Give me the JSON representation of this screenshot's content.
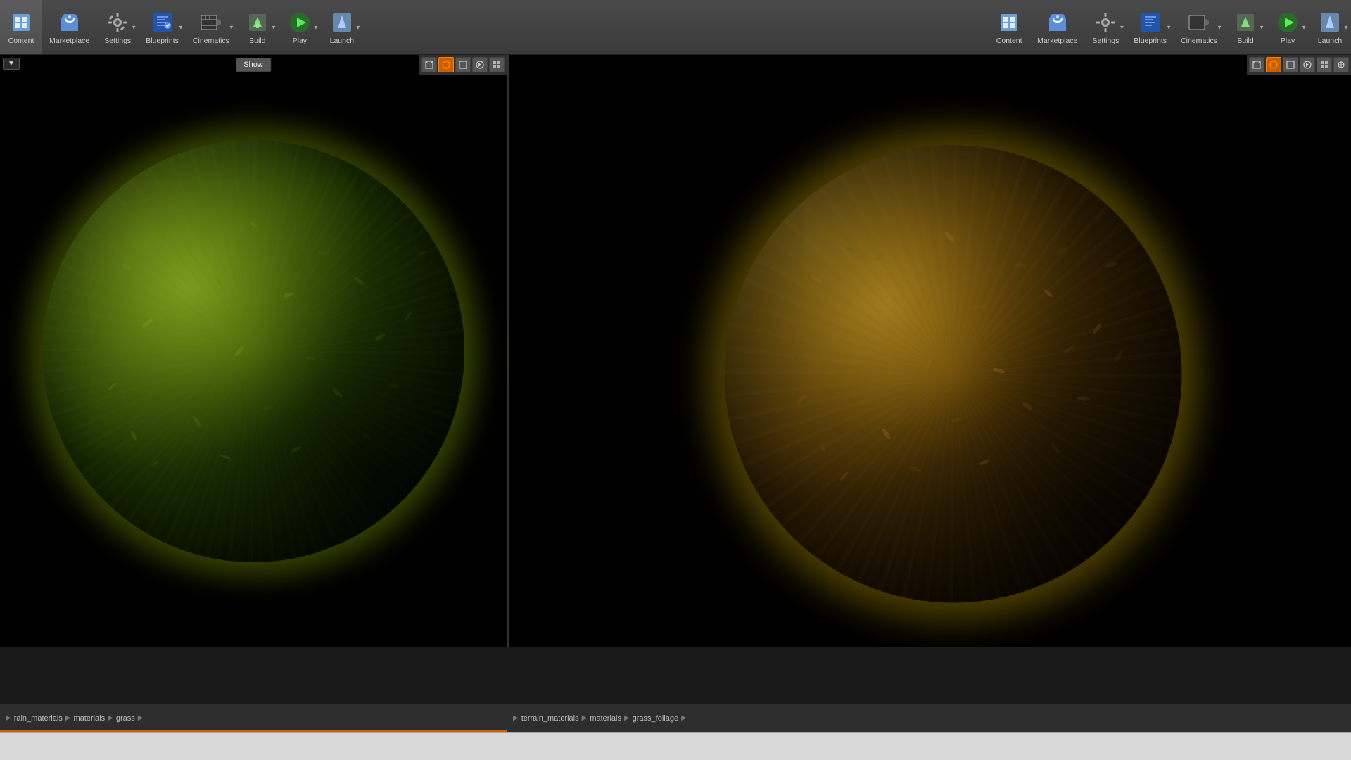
{
  "toolbar_left": {
    "buttons": [
      {
        "id": "content",
        "label": "Content",
        "icon": "content-icon"
      },
      {
        "id": "marketplace",
        "label": "Marketplace",
        "icon": "marketplace-icon",
        "has_dropdown": false
      },
      {
        "id": "settings",
        "label": "Settings",
        "icon": "settings-icon",
        "has_dropdown": true
      },
      {
        "id": "blueprints",
        "label": "Blueprints",
        "icon": "blueprints-icon",
        "has_dropdown": true
      },
      {
        "id": "cinematics",
        "label": "Cinematics",
        "icon": "cinematics-icon",
        "has_dropdown": true
      },
      {
        "id": "build",
        "label": "Build",
        "icon": "build-icon",
        "has_dropdown": true
      },
      {
        "id": "play",
        "label": "Play",
        "icon": "play-icon",
        "has_dropdown": true
      },
      {
        "id": "launch",
        "label": "Launch",
        "icon": "launch-icon",
        "has_dropdown": true
      }
    ]
  },
  "toolbar_right": {
    "buttons": [
      {
        "id": "content2",
        "label": "Content",
        "icon": "content-icon"
      },
      {
        "id": "marketplace2",
        "label": "Marketplace",
        "icon": "marketplace-icon"
      },
      {
        "id": "settings2",
        "label": "Settings",
        "icon": "settings-icon",
        "has_dropdown": true
      },
      {
        "id": "blueprints2",
        "label": "Blueprints",
        "icon": "blueprints-icon",
        "has_dropdown": true
      },
      {
        "id": "cinematics2",
        "label": "Cinematics",
        "icon": "cinematics-icon",
        "has_dropdown": true
      },
      {
        "id": "build2",
        "label": "Build",
        "icon": "build-icon",
        "has_dropdown": true
      },
      {
        "id": "play2",
        "label": "Play",
        "icon": "play-icon",
        "has_dropdown": true
      },
      {
        "id": "launch2",
        "label": "Launch",
        "icon": "launch-icon",
        "has_dropdown": true
      }
    ]
  },
  "viewport_left": {
    "show_btn": "Show",
    "breadcrumb": [
      "rain_materials",
      "materials",
      "grass"
    ]
  },
  "viewport_right": {
    "breadcrumb": [
      "terrain_materials",
      "materials",
      "grass_foliage"
    ]
  },
  "colors": {
    "toolbar_bg": "#3d3d3d",
    "accent_orange": "#c86000",
    "viewport_bg": "#000000",
    "breadcrumb_bg": "#2d2d2d"
  }
}
